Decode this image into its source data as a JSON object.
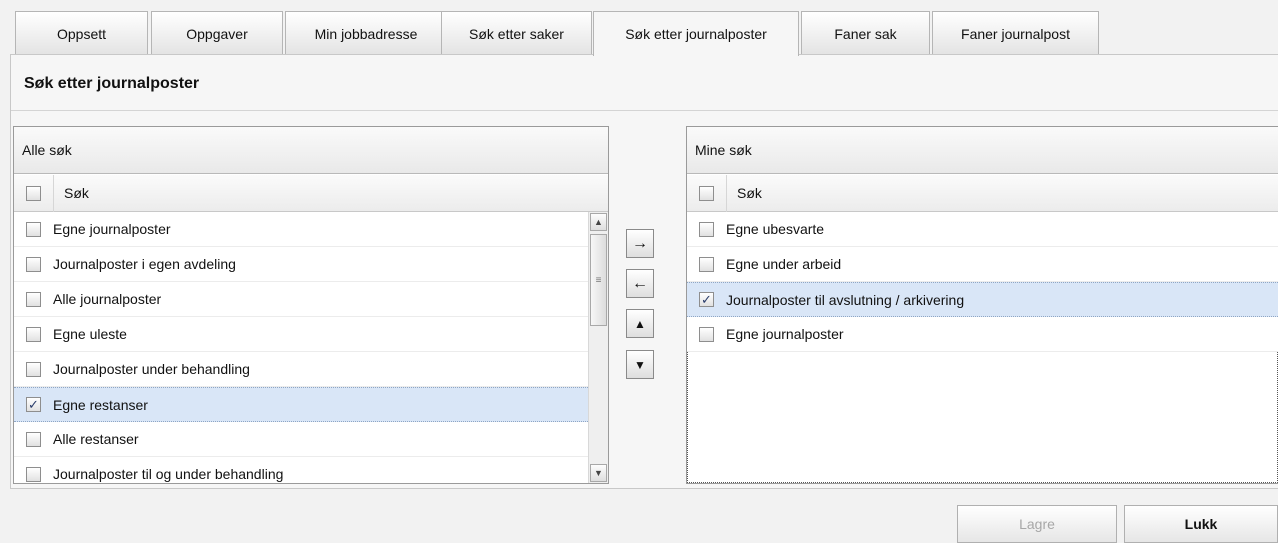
{
  "tabs": [
    {
      "label": "Oppsett",
      "active": false
    },
    {
      "label": "Oppgaver",
      "active": false
    },
    {
      "label": "Min jobbadresse",
      "active": false
    },
    {
      "label": "Søk etter saker",
      "active": false
    },
    {
      "label": "Søk etter journalposter",
      "active": true
    },
    {
      "label": "Faner sak",
      "active": false
    },
    {
      "label": "Faner journalpost",
      "active": false
    }
  ],
  "panel": {
    "title": "Søk etter journalposter"
  },
  "all_searches": {
    "caption": "Alle søk",
    "column": "Søk",
    "rows": [
      {
        "label": "Egne journalposter",
        "checked": false
      },
      {
        "label": "Journalposter i egen avdeling",
        "checked": false
      },
      {
        "label": "Alle journalposter",
        "checked": false
      },
      {
        "label": "Egne uleste",
        "checked": false
      },
      {
        "label": "Journalposter under behandling",
        "checked": false
      },
      {
        "label": "Egne restanser",
        "checked": true
      },
      {
        "label": "Alle restanser",
        "checked": false
      },
      {
        "label": "Journalposter til og under behandling",
        "checked": false
      }
    ]
  },
  "my_searches": {
    "caption": "Mine søk",
    "column": "Søk",
    "rows": [
      {
        "label": "Egne ubesvarte",
        "checked": false
      },
      {
        "label": "Egne under arbeid",
        "checked": false
      },
      {
        "label": "Journalposter til avslutning / arkivering",
        "checked": true
      },
      {
        "label": "Egne journalposter",
        "checked": false
      }
    ]
  },
  "move_buttons": {
    "add": "→",
    "remove": "←",
    "up": "▲",
    "down": "▼"
  },
  "footer": {
    "save_label": "Lagre",
    "close_label": "Lukk"
  },
  "check_glyph": "✓"
}
